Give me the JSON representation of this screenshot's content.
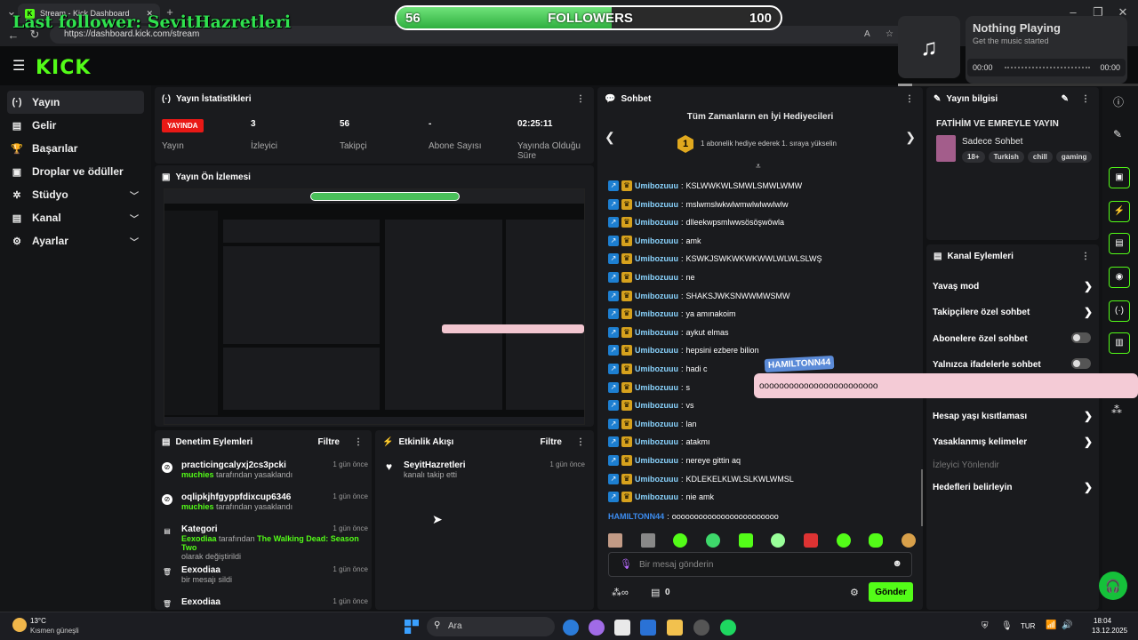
{
  "browser": {
    "tab_title": "Stream - Kick Dashboard",
    "url": "https://dashboard.kick.com/stream"
  },
  "overlay": {
    "last_follower": "Last follower: SevitHazretleri",
    "goal": {
      "current": "56",
      "label": "FOLLOWERS",
      "target": "100",
      "progress": 0.56
    },
    "music": {
      "title": "Nothing Playing",
      "subtitle": "Get the music started",
      "time_start": "00:00",
      "time_end": "00:00"
    }
  },
  "brand": {
    "logo": "KICK",
    "accent": "#53fc18"
  },
  "sidebar": {
    "items": [
      {
        "label": "Yayın",
        "icon": "(·)"
      },
      {
        "label": "Gelir",
        "icon": "▤"
      },
      {
        "label": "Başarılar",
        "icon": "🏆"
      },
      {
        "label": "Droplar ve ödüller",
        "icon": "▣"
      },
      {
        "label": "Stüdyo",
        "icon": "✲"
      },
      {
        "label": "Kanal",
        "icon": "▤"
      },
      {
        "label": "Ayarlar",
        "icon": "⚙"
      }
    ]
  },
  "stats": {
    "title": "Yayın İstatistikleri",
    "live": "YAYINDA",
    "live_label": "Yayın",
    "viewers": "3",
    "viewers_label": "İzleyici",
    "followers": "56",
    "followers_label": "Takipçi",
    "subs": "-",
    "subs_label": "Abone Sayısı",
    "duration": "02:25:11",
    "duration_label": "Yayında Olduğu Süre"
  },
  "preview": {
    "title": "Yayın Ön İzlemesi"
  },
  "moderation": {
    "title": "Denetim Eylemleri",
    "filter": "Filtre",
    "rows": [
      {
        "user": "practicingcalyxj2cs3pcki",
        "time": "1 gün önce",
        "by": "muchies",
        "rest": "tarafından yasaklandı"
      },
      {
        "user": "oqlipkjhfgyppfdixcup6346",
        "time": "1 gün önce",
        "by": "muchies",
        "rest": "tarafından yasaklandı"
      },
      {
        "user": "Kategori",
        "time": "1 gün önce",
        "by": "Eexodiaa",
        "mid": "tarafından",
        "cat": "The Walking Dead: Season Two",
        "rest": "olarak değiştirildi"
      },
      {
        "user": "Eexodiaa",
        "time": "1 gün önce",
        "rest": "bir mesajı sildi"
      },
      {
        "user": "Eexodiaa",
        "time": "1 gün önce"
      }
    ]
  },
  "activity": {
    "title": "Etkinlik Akışı",
    "filter": "Filtre",
    "user": "SeyitHazretleri",
    "time": "1 gün önce",
    "text": "kanalı takip etti"
  },
  "chat": {
    "title": "Sohbet",
    "gifters_title": "Tüm Zamanların en İyi Hediyecileri",
    "gifters_text": "1 abonelik hediye ederek 1. sıraya yükselin",
    "gifters_rank": "1",
    "user": "Umibozuuu",
    "messages": [
      "KSLWWKWLSMWLSMWLWMW",
      "mslwmslwkwlwmwlwlwwlwlw",
      "dlleekwpsmlwwsösöşwöwla",
      "amk",
      "KSWKJSWKWKWKWWLWLWLSLWŞ",
      "ne",
      "SHAKSJWKSNWWMWSMW",
      "ya amınakoim",
      "aykut elmas",
      "hepsini ezbere bilion",
      "hadi c",
      "s",
      "vs",
      "lan",
      "atakmı",
      "nereye gittin aq",
      "KDLEKELKLWLSLKWLWMSL",
      "nie amk"
    ],
    "last_user": "HAMILTONN44",
    "last_msg": "oooooooooooooooooooooooo",
    "tts_name": "HAMILTONN44",
    "tts_msg": "oooooooooooooooooooooooo",
    "input_placeholder": "Bir mesaj gönderin",
    "points": "0",
    "send": "Gönder"
  },
  "stream_info": {
    "title": "Yayın bilgisi",
    "stream_title": "FATİHİM VE EMREYLE YAYIN",
    "category": "Sadece Sohbet",
    "tags": [
      "18+",
      "Turkish",
      "chill",
      "gaming"
    ]
  },
  "channel_actions": {
    "title": "Kanal Eylemleri",
    "slow": "Yavaş mod",
    "followers_only": "Takipçilere özel sohbet",
    "subs_only": "Abonelere özel sohbet",
    "emotes_only": "Yalnızca ifadelerle sohbet",
    "age": "Hesap yaşı kısıtlaması",
    "banned_words": "Yasaklanmış kelimeler",
    "viewer_section": "İzleyici Yönlendir",
    "goals": "Hedefleri belirleyin"
  },
  "taskbar": {
    "weather_temp": "13°C",
    "weather_text": "Kısmen güneşli",
    "search": "Ara",
    "lang": "TUR",
    "time": "18:04",
    "date": "13.12.2025"
  }
}
